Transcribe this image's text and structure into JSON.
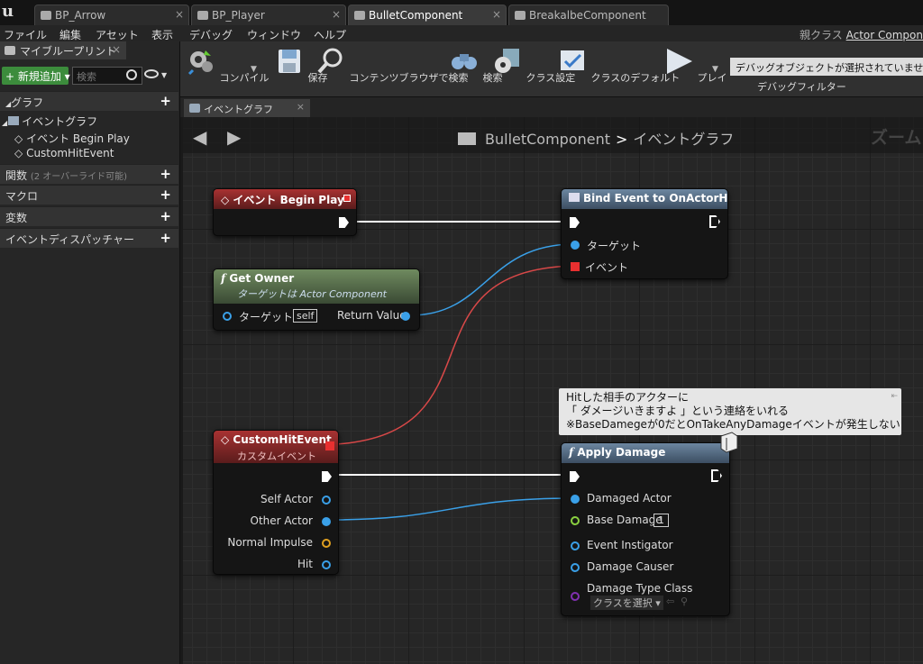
{
  "tabs": [
    "BP_Arrow",
    "BP_Player",
    "BulletComponent",
    "BreakalbeComponent"
  ],
  "menu": [
    "ファイル",
    "編集",
    "アセット",
    "表示",
    "デバッグ",
    "ウィンドウ",
    "ヘルプ"
  ],
  "parent_class": {
    "label": "親クラス",
    "value": "Actor Compon"
  },
  "left_panel": {
    "title": "マイブループリント",
    "add_button": "+ 新規追加 ▾",
    "search_placeholder": "検索",
    "sections": {
      "graph": "グラフ",
      "functions": "関数",
      "functions_note": "(2 オーバーライド可能)",
      "macros": "マクロ",
      "variables": "変数",
      "dispatchers": "イベントディスパッチャー"
    },
    "tree": [
      "イベントグラフ",
      "イベント Begin Play",
      "CustomHitEvent"
    ]
  },
  "toolbar": {
    "compile": "コンパイル",
    "save": "保存",
    "browse": "コンテンツブラウザで検索",
    "search": "検索",
    "class_settings": "クラス設定",
    "class_defaults": "クラスのデフォルト",
    "play": "プレイ",
    "debug_object": "デバッグオブジェクトが選択されていませ",
    "debug_filter": "デバッグフィルター"
  },
  "graph_tab": "イベントグラフ",
  "breadcrumb": {
    "component": "BulletComponent",
    "separator": ">",
    "graph": "イベントグラフ"
  },
  "zoom_label": "ズーム",
  "nodes": {
    "begin_play": {
      "title": "イベント Begin Play"
    },
    "bind_event": {
      "title": "Bind Event to OnActorHit",
      "pin_target": "ターゲット",
      "pin_event": "イベント"
    },
    "get_owner": {
      "title": "Get Owner",
      "subtitle": "ターゲットは Actor Component",
      "pin_target": "ターゲット",
      "self": "self",
      "return": "Return Value"
    },
    "custom_hit": {
      "title": "CustomHitEvent",
      "subtitle": "カスタムイベント",
      "pins": [
        "Self Actor",
        "Other Actor",
        "Normal Impulse",
        "Hit"
      ]
    },
    "apply_damage": {
      "title": "Apply Damage",
      "pins": [
        "Damaged Actor",
        "Base Damage",
        "Event Instigator",
        "Damage Causer",
        "Damage Type Class"
      ],
      "base_damage_value": "1",
      "class_select": "クラスを選択 ▾"
    }
  },
  "comment": [
    "Hitした相手のアクターに",
    "「 ダメージいきますよ 」という連絡をいれる",
    "※BaseDamegeが0だとOnTakeAnyDamageイベントが発生しない"
  ],
  "colors": {
    "exec": "#ffffff",
    "object_pin": "#3aa0e8",
    "delegate_pin": "#e83030",
    "float_pin": "#8ad040",
    "vector_pin": "#e0a020",
    "class_pin": "#8030b0",
    "event_header": "#a83232",
    "pure_header": "#6f8a5f",
    "func_header": "#6c86a0"
  }
}
